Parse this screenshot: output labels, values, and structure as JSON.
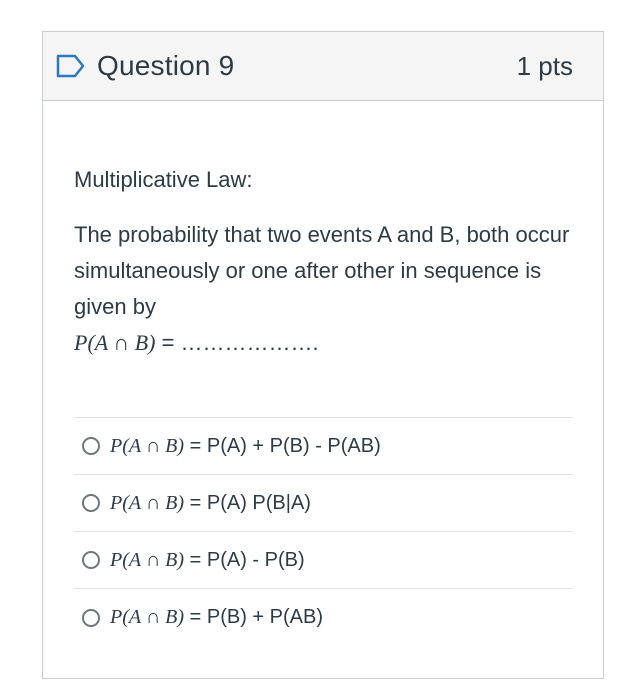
{
  "question": {
    "title": "Question 9",
    "points": "1 pts"
  },
  "body": {
    "heading": "Multiplicative Law:",
    "text": "The probability that two events A and B, both occur simultaneously or one after other in sequence is given by",
    "formula_lhs": "P(A ∩ B)",
    "formula_rhs": " = ………………."
  },
  "answers": [
    {
      "lhs": "P(A ∩ B)",
      "rhs": " = P(A) + P(B) - P(AB)"
    },
    {
      "lhs": "P(A ∩ B)",
      "rhs": " = P(A) P(B|A)"
    },
    {
      "lhs": "P(A ∩ B)",
      "rhs": " = P(A) - P(B)"
    },
    {
      "lhs": "P(A ∩ B)",
      "rhs": " = P(B) + P(AB)"
    }
  ],
  "icons": {
    "flag": "flag-icon",
    "radio": "radio-icon"
  },
  "colors": {
    "header_bg": "#f5f5f5",
    "border": "#c7cdd1",
    "text": "#2d3b45",
    "flag_blue": "#2b7abc"
  }
}
